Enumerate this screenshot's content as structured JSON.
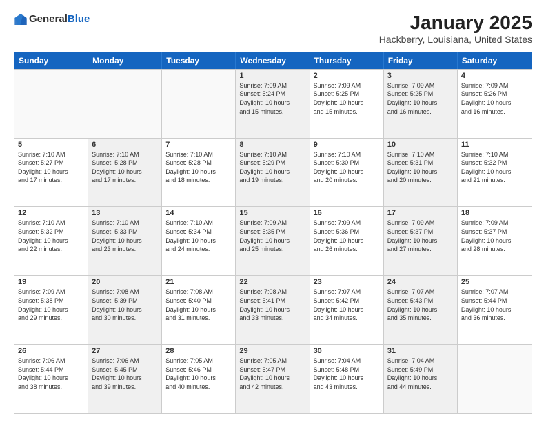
{
  "logo": {
    "general": "General",
    "blue": "Blue"
  },
  "title": "January 2025",
  "subtitle": "Hackberry, Louisiana, United States",
  "weekdays": [
    "Sunday",
    "Monday",
    "Tuesday",
    "Wednesday",
    "Thursday",
    "Friday",
    "Saturday"
  ],
  "rows": [
    [
      {
        "day": "",
        "lines": [],
        "empty": true
      },
      {
        "day": "",
        "lines": [],
        "empty": true
      },
      {
        "day": "",
        "lines": [],
        "empty": true
      },
      {
        "day": "1",
        "lines": [
          "Sunrise: 7:09 AM",
          "Sunset: 5:24 PM",
          "Daylight: 10 hours",
          "and 15 minutes."
        ],
        "shaded": true
      },
      {
        "day": "2",
        "lines": [
          "Sunrise: 7:09 AM",
          "Sunset: 5:25 PM",
          "Daylight: 10 hours",
          "and 15 minutes."
        ]
      },
      {
        "day": "3",
        "lines": [
          "Sunrise: 7:09 AM",
          "Sunset: 5:25 PM",
          "Daylight: 10 hours",
          "and 16 minutes."
        ],
        "shaded": true
      },
      {
        "day": "4",
        "lines": [
          "Sunrise: 7:09 AM",
          "Sunset: 5:26 PM",
          "Daylight: 10 hours",
          "and 16 minutes."
        ]
      }
    ],
    [
      {
        "day": "5",
        "lines": [
          "Sunrise: 7:10 AM",
          "Sunset: 5:27 PM",
          "Daylight: 10 hours",
          "and 17 minutes."
        ]
      },
      {
        "day": "6",
        "lines": [
          "Sunrise: 7:10 AM",
          "Sunset: 5:28 PM",
          "Daylight: 10 hours",
          "and 17 minutes."
        ],
        "shaded": true
      },
      {
        "day": "7",
        "lines": [
          "Sunrise: 7:10 AM",
          "Sunset: 5:28 PM",
          "Daylight: 10 hours",
          "and 18 minutes."
        ]
      },
      {
        "day": "8",
        "lines": [
          "Sunrise: 7:10 AM",
          "Sunset: 5:29 PM",
          "Daylight: 10 hours",
          "and 19 minutes."
        ],
        "shaded": true
      },
      {
        "day": "9",
        "lines": [
          "Sunrise: 7:10 AM",
          "Sunset: 5:30 PM",
          "Daylight: 10 hours",
          "and 20 minutes."
        ]
      },
      {
        "day": "10",
        "lines": [
          "Sunrise: 7:10 AM",
          "Sunset: 5:31 PM",
          "Daylight: 10 hours",
          "and 20 minutes."
        ],
        "shaded": true
      },
      {
        "day": "11",
        "lines": [
          "Sunrise: 7:10 AM",
          "Sunset: 5:32 PM",
          "Daylight: 10 hours",
          "and 21 minutes."
        ]
      }
    ],
    [
      {
        "day": "12",
        "lines": [
          "Sunrise: 7:10 AM",
          "Sunset: 5:32 PM",
          "Daylight: 10 hours",
          "and 22 minutes."
        ]
      },
      {
        "day": "13",
        "lines": [
          "Sunrise: 7:10 AM",
          "Sunset: 5:33 PM",
          "Daylight: 10 hours",
          "and 23 minutes."
        ],
        "shaded": true
      },
      {
        "day": "14",
        "lines": [
          "Sunrise: 7:10 AM",
          "Sunset: 5:34 PM",
          "Daylight: 10 hours",
          "and 24 minutes."
        ]
      },
      {
        "day": "15",
        "lines": [
          "Sunrise: 7:09 AM",
          "Sunset: 5:35 PM",
          "Daylight: 10 hours",
          "and 25 minutes."
        ],
        "shaded": true
      },
      {
        "day": "16",
        "lines": [
          "Sunrise: 7:09 AM",
          "Sunset: 5:36 PM",
          "Daylight: 10 hours",
          "and 26 minutes."
        ]
      },
      {
        "day": "17",
        "lines": [
          "Sunrise: 7:09 AM",
          "Sunset: 5:37 PM",
          "Daylight: 10 hours",
          "and 27 minutes."
        ],
        "shaded": true
      },
      {
        "day": "18",
        "lines": [
          "Sunrise: 7:09 AM",
          "Sunset: 5:37 PM",
          "Daylight: 10 hours",
          "and 28 minutes."
        ]
      }
    ],
    [
      {
        "day": "19",
        "lines": [
          "Sunrise: 7:09 AM",
          "Sunset: 5:38 PM",
          "Daylight: 10 hours",
          "and 29 minutes."
        ]
      },
      {
        "day": "20",
        "lines": [
          "Sunrise: 7:08 AM",
          "Sunset: 5:39 PM",
          "Daylight: 10 hours",
          "and 30 minutes."
        ],
        "shaded": true
      },
      {
        "day": "21",
        "lines": [
          "Sunrise: 7:08 AM",
          "Sunset: 5:40 PM",
          "Daylight: 10 hours",
          "and 31 minutes."
        ]
      },
      {
        "day": "22",
        "lines": [
          "Sunrise: 7:08 AM",
          "Sunset: 5:41 PM",
          "Daylight: 10 hours",
          "and 33 minutes."
        ],
        "shaded": true
      },
      {
        "day": "23",
        "lines": [
          "Sunrise: 7:07 AM",
          "Sunset: 5:42 PM",
          "Daylight: 10 hours",
          "and 34 minutes."
        ]
      },
      {
        "day": "24",
        "lines": [
          "Sunrise: 7:07 AM",
          "Sunset: 5:43 PM",
          "Daylight: 10 hours",
          "and 35 minutes."
        ],
        "shaded": true
      },
      {
        "day": "25",
        "lines": [
          "Sunrise: 7:07 AM",
          "Sunset: 5:44 PM",
          "Daylight: 10 hours",
          "and 36 minutes."
        ]
      }
    ],
    [
      {
        "day": "26",
        "lines": [
          "Sunrise: 7:06 AM",
          "Sunset: 5:44 PM",
          "Daylight: 10 hours",
          "and 38 minutes."
        ]
      },
      {
        "day": "27",
        "lines": [
          "Sunrise: 7:06 AM",
          "Sunset: 5:45 PM",
          "Daylight: 10 hours",
          "and 39 minutes."
        ],
        "shaded": true
      },
      {
        "day": "28",
        "lines": [
          "Sunrise: 7:05 AM",
          "Sunset: 5:46 PM",
          "Daylight: 10 hours",
          "and 40 minutes."
        ]
      },
      {
        "day": "29",
        "lines": [
          "Sunrise: 7:05 AM",
          "Sunset: 5:47 PM",
          "Daylight: 10 hours",
          "and 42 minutes."
        ],
        "shaded": true
      },
      {
        "day": "30",
        "lines": [
          "Sunrise: 7:04 AM",
          "Sunset: 5:48 PM",
          "Daylight: 10 hours",
          "and 43 minutes."
        ]
      },
      {
        "day": "31",
        "lines": [
          "Sunrise: 7:04 AM",
          "Sunset: 5:49 PM",
          "Daylight: 10 hours",
          "and 44 minutes."
        ],
        "shaded": true
      },
      {
        "day": "",
        "lines": [],
        "empty": true
      }
    ]
  ]
}
